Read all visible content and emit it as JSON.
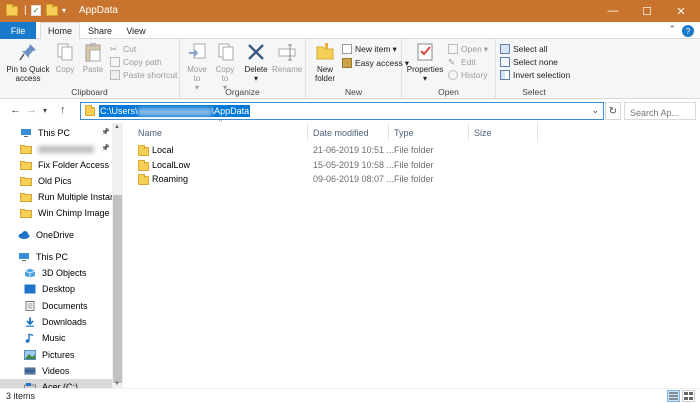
{
  "window": {
    "title": "AppData",
    "controls": {
      "minimize": "—",
      "maximize": "☐",
      "close": "✕"
    }
  },
  "ribbon_tabs": [
    "File",
    "Home",
    "Share",
    "View"
  ],
  "ribbon": {
    "clipboard": {
      "label": "Clipboard",
      "pin": "Pin to Quick access",
      "copy": "Copy",
      "paste": "Paste",
      "cut": "Cut",
      "copy_path": "Copy path",
      "paste_shortcut": "Paste shortcut"
    },
    "organize": {
      "label": "Organize",
      "move_to": "Move to",
      "copy_to": "Copy to",
      "delete": "Delete",
      "rename": "Rename"
    },
    "new": {
      "label": "New",
      "new_folder": "New folder",
      "new_item": "New item",
      "easy_access": "Easy access"
    },
    "open": {
      "label": "Open",
      "properties": "Properties",
      "open": "Open",
      "edit": "Edit",
      "history": "History"
    },
    "select": {
      "label": "Select",
      "select_all": "Select all",
      "select_none": "Select none",
      "invert": "Invert selection"
    }
  },
  "address": {
    "path": "C:\\Users\\          \\AppData",
    "search_placeholder": "Search Ap..."
  },
  "nav": {
    "quick": [
      {
        "label": "This PC",
        "icon": "monitor-icon",
        "pinned": true
      },
      {
        "label": "",
        "icon": "folder-icon",
        "pinned": true
      },
      {
        "label": "Fix Folder Access Der",
        "icon": "folder-icon",
        "pinned": false
      },
      {
        "label": "Old Pics",
        "icon": "folder-icon",
        "pinned": false
      },
      {
        "label": "Run Multiple Instanc",
        "icon": "folder-icon",
        "pinned": false
      },
      {
        "label": "Win Chimp Image",
        "icon": "folder-icon",
        "pinned": false
      }
    ],
    "onedrive": "OneDrive",
    "thispc": "This PC",
    "pc_items": [
      {
        "label": "3D Objects",
        "icon": "cube-icon"
      },
      {
        "label": "Desktop",
        "icon": "desktop-icon"
      },
      {
        "label": "Documents",
        "icon": "document-icon"
      },
      {
        "label": "Downloads",
        "icon": "download-icon"
      },
      {
        "label": "Music",
        "icon": "music-icon"
      },
      {
        "label": "Pictures",
        "icon": "pictures-icon"
      },
      {
        "label": "Videos",
        "icon": "video-icon"
      },
      {
        "label": "Acer (C:)",
        "icon": "drive-icon"
      }
    ]
  },
  "columns": {
    "name": "Name",
    "date": "Date modified",
    "type": "Type",
    "size": "Size"
  },
  "files": [
    {
      "name": "Local",
      "date": "21-06-2019 10:51 ...",
      "type": "File folder"
    },
    {
      "name": "LocalLow",
      "date": "15-05-2019 10:58 ...",
      "type": "File folder"
    },
    {
      "name": "Roaming",
      "date": "09-06-2019 08:07 ...",
      "type": "File folder"
    }
  ],
  "status": {
    "items": "3 items"
  },
  "colors": {
    "titlebar": "#c8742e",
    "file_tab": "#1979ca",
    "accent": "#0078d7",
    "folder": "#f6cf57"
  }
}
